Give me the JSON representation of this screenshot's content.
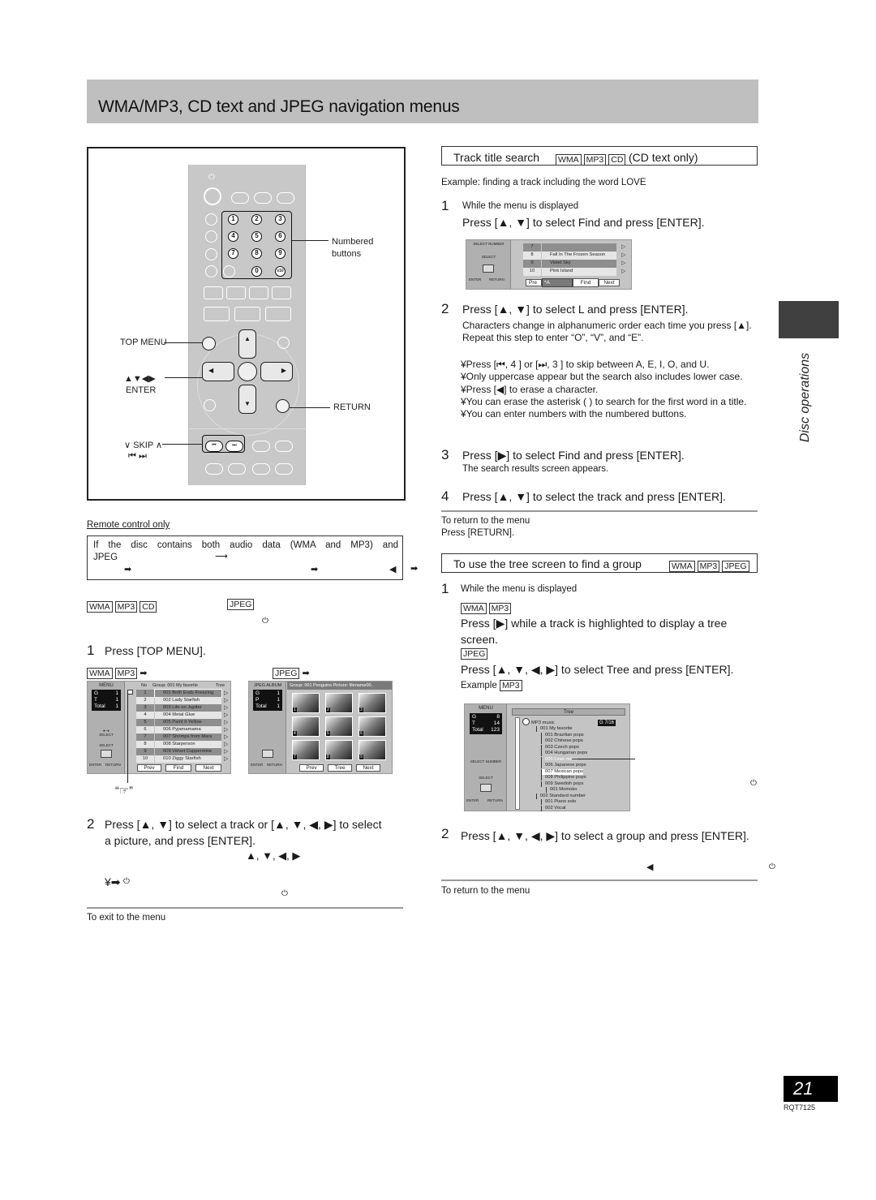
{
  "header": {
    "title": "WMA/MP3, CD text and JPEG navigation menus"
  },
  "remote": {
    "labels": {
      "numbered": "Numbered",
      "buttons": "buttons",
      "top_menu": "TOP MENU",
      "arrows": "▲▼◀▶",
      "enter": "ENTER",
      "return": "RETURN",
      "skip": "∨ SKIP ∧",
      "skip_icons": "⏮ ⏭"
    },
    "numbers": [
      "1",
      "2",
      "3",
      "4",
      "5",
      "6",
      "7",
      "8",
      "9",
      "0",
      "≥10"
    ]
  },
  "left": {
    "remote_only": "Remote control only",
    "notice_line1": "If the disc contains both audio data (WMA and MP3) and",
    "notice_line2": "JPEG",
    "tags_a": [
      "WMA",
      "MP3",
      "CD"
    ],
    "tag_b": "JPEG",
    "step1_num": "1",
    "step1": "Press [TOP MENU].",
    "osd_label_audio": [
      "WMA",
      "MP3"
    ],
    "osd_label_jpeg": "JPEG",
    "pointer_label": "“☞”",
    "step2_num": "2",
    "step2_line1": "Press [▲, ▼] to select a track or [▲, ▼, ◀, ▶] to select",
    "step2_line2": "a picture, and press [ENTER].",
    "step2_arrows": "▲, ▼, ◀, ▶",
    "exit_heading": "To exit to the menu"
  },
  "osd_audio": {
    "side_title": "MENU",
    "stats": [
      [
        "G",
        "1"
      ],
      [
        "T",
        "1"
      ],
      [
        "Total",
        "1"
      ]
    ],
    "select_number": "SELECT\nNUMBER",
    "select": "SELECT",
    "enter": "ENTER",
    "return": "RETURN",
    "header_no": "No",
    "header_group": "Group: 001 My favorite",
    "header_tree": "Tree",
    "tracks": [
      {
        "no": "1",
        "title": "001 Both Ends Freezing"
      },
      {
        "no": "2",
        "title": "002 Lady Starfish"
      },
      {
        "no": "3",
        "title": "003 Life on Jupiter"
      },
      {
        "no": "4",
        "title": "004 Metal Glue"
      },
      {
        "no": "5",
        "title": "005 Paint It Yellow"
      },
      {
        "no": "6",
        "title": "006 Pyjamamama"
      },
      {
        "no": "7",
        "title": "007 Shrimps from Mars"
      },
      {
        "no": "8",
        "title": "008 Starperson"
      },
      {
        "no": "9",
        "title": "009 Velvet Cuppermine"
      },
      {
        "no": "10",
        "title": "010 Ziggy Starfish"
      }
    ],
    "buttons": [
      "Prev",
      "Find",
      "Next"
    ]
  },
  "osd_jpeg": {
    "side_title": "JPEG ALBUM",
    "stats": [
      [
        "G",
        "1"
      ],
      [
        "P",
        "1"
      ],
      [
        "Total",
        "1"
      ]
    ],
    "header": "Group:  001 Penguins   Picture: filename00..",
    "thumbs": [
      "1",
      "2",
      "3",
      "4",
      "5",
      "6",
      "7",
      "8",
      "9"
    ],
    "buttons": [
      "Prev",
      "Tree",
      "Next"
    ]
  },
  "right": {
    "search_title": "Track title search",
    "search_tags": [
      "WMA",
      "MP3",
      "CD"
    ],
    "search_note": "(CD text only)",
    "example": "Example: finding a track including the word  LOVE",
    "s1_num": "1",
    "s1_sub": "While the menu is displayed",
    "s1": "Press [▲, ▼] to select  Find  and press [ENTER].",
    "find_osd": {
      "rows": [
        {
          "no": "7",
          "title": ""
        },
        {
          "no": "8",
          "title": "Fall In The Frozen Season"
        },
        {
          "no": "9",
          "title": "Violet Sky"
        },
        {
          "no": "10",
          "title": "Pink Island"
        }
      ],
      "prev": "Pre",
      "input": "*A",
      "find": "Find",
      "next": "Next",
      "select_number": "SELECT NUMBER",
      "select": "SELECT",
      "enter": "ENTER",
      "return": "RETURN"
    },
    "s2_num": "2",
    "s2": "Press [▲, ▼] to select   L   and press [ENTER].",
    "s2_notes": [
      "Characters change in alphanumeric order each time you press [▲].",
      "Repeat this step to enter “O”, “V”, and “E”."
    ],
    "s2_bullets": [
      "¥Press [⏮, 4 ] or [⏭, 3 ] to skip between A, E, I, O, and U.",
      "¥Only uppercase appear but the search also includes lower case.",
      "¥Press [◀] to erase a character.",
      "¥You can erase the asterisk (   ) to search for the first word in a title.",
      "¥You can enter numbers with the numbered buttons."
    ],
    "s3_num": "3",
    "s3": "Press [▶] to select   Find   and press [ENTER].",
    "s3_note": "The search results screen appears.",
    "s4_num": "4",
    "s4": "Press [▲, ▼] to select the track and press [ENTER].",
    "return_heading": "To return to the menu",
    "return_text": "Press [RETURN].",
    "tree_title": "To use the tree screen to find a group",
    "tree_tags": [
      "WMA",
      "MP3",
      "JPEG"
    ],
    "t1_num": "1",
    "t1_sub": "While the menu is displayed",
    "t1_tags": [
      "WMA",
      "MP3"
    ],
    "t1_a": "Press [▶] while a track is highlighted to display a tree screen.",
    "t1_tag_jpeg": "JPEG",
    "t1_b": "Press [▲, ▼, ◀, ▶] to select   Tree   and press [ENTER].",
    "example_label": "Example",
    "example_tag": "MP3",
    "t2_num": "2",
    "t2": "Press [▲, ▼, ◀, ▶] to select a group and press [ENTER].",
    "return_heading2": "To return to the menu"
  },
  "tree_osd": {
    "side_title": "MENU",
    "stats": [
      [
        "G",
        "8"
      ],
      [
        "T",
        "14"
      ],
      [
        "Total",
        "123"
      ]
    ],
    "header": "Tree",
    "counter": "G  7/16",
    "root": "MP3 music",
    "nodes": [
      {
        "label": "001 My favorite",
        "level": 1
      },
      {
        "label": "001 Brazilian pops",
        "level": 2
      },
      {
        "label": "002 Chinese pops",
        "level": 2
      },
      {
        "label": "003 Czech pops",
        "level": 2
      },
      {
        "label": "004 Hungarian pops",
        "level": 2
      },
      {
        "label": "005 Liner notes",
        "level": 2,
        "highlight": true
      },
      {
        "label": "006 Japanese pops",
        "level": 2
      },
      {
        "label": "007 Mexican pops",
        "level": 2,
        "selected": true
      },
      {
        "label": "008 Philippine pops",
        "level": 2
      },
      {
        "label": "009 Swedish pops",
        "level": 2
      },
      {
        "label": "001 Momoko",
        "level": 3
      },
      {
        "label": "002 Standard number",
        "level": 1
      },
      {
        "label": "001 Piano solo",
        "level": 2
      },
      {
        "label": "002 Vocal",
        "level": 2
      }
    ]
  },
  "side": {
    "section": "Disc operations"
  },
  "footer": {
    "page": "21",
    "code": "RQT7125"
  }
}
